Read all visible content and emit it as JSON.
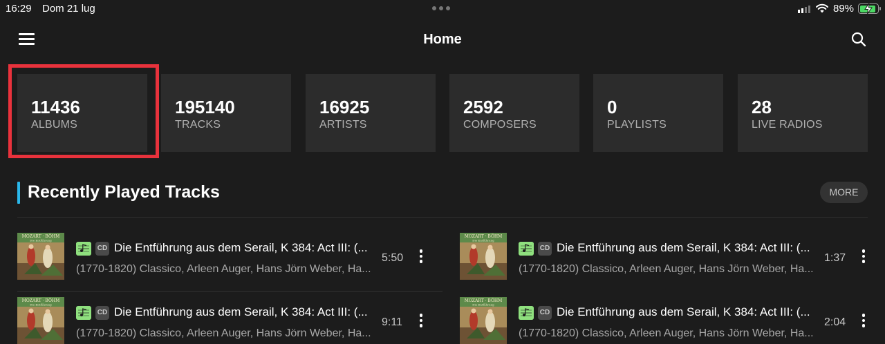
{
  "status_bar": {
    "time": "16:29",
    "date": "Dom 21 lug",
    "battery_percent": "89%",
    "battery_level": 0.89,
    "battery_color": "#4cd964",
    "icons": [
      "signal-icon",
      "wifi-icon",
      "battery-charging-icon"
    ]
  },
  "header": {
    "title": "Home",
    "menu_icon": "hamburger-menu-icon",
    "search_icon": "search-icon"
  },
  "stats": [
    {
      "value": "11436",
      "label": "ALBUMS",
      "highlighted": true
    },
    {
      "value": "195140",
      "label": "TRACKS"
    },
    {
      "value": "16925",
      "label": "ARTISTS"
    },
    {
      "value": "2592",
      "label": "COMPOSERS"
    },
    {
      "value": "0",
      "label": "PLAYLISTS"
    },
    {
      "value": "28",
      "label": "LIVE RADIOS"
    }
  ],
  "recent": {
    "title": "Recently Played Tracks",
    "more_label": "MORE",
    "accent_color": "#2ab7ea",
    "tracks": [
      {
        "title": "Die Entführung aus dem Serail, K 384: Act III: (...",
        "subtitle": "(1770-1820) Classico, Arleen Auger, Hans Jörn Weber, Ha...",
        "duration": "5:50",
        "format_badge": "CD",
        "quality_icon": "hires-audio-icon"
      },
      {
        "title": "Die Entführung aus dem Serail, K 384: Act III: (...",
        "subtitle": "(1770-1820) Classico, Arleen Auger, Hans Jörn Weber, Ha...",
        "duration": "1:37",
        "format_badge": "CD",
        "quality_icon": "hires-audio-icon"
      },
      {
        "title": "Die Entführung aus dem Serail, K 384: Act III: (...",
        "subtitle": "(1770-1820) Classico, Arleen Auger, Hans Jörn Weber, Ha...",
        "duration": "9:11",
        "format_badge": "CD",
        "quality_icon": "hires-audio-icon"
      },
      {
        "title": "Die Entführung aus dem Serail, K 384: Act III: (...",
        "subtitle": "(1770-1820) Classico, Arleen Auger, Hans Jörn Weber, Ha...",
        "duration": "2:04",
        "format_badge": "CD",
        "quality_icon": "hires-audio-icon"
      }
    ]
  },
  "colors": {
    "background": "#1c1c1c",
    "card": "#2c2c2c",
    "highlight_border": "#e8323c"
  }
}
